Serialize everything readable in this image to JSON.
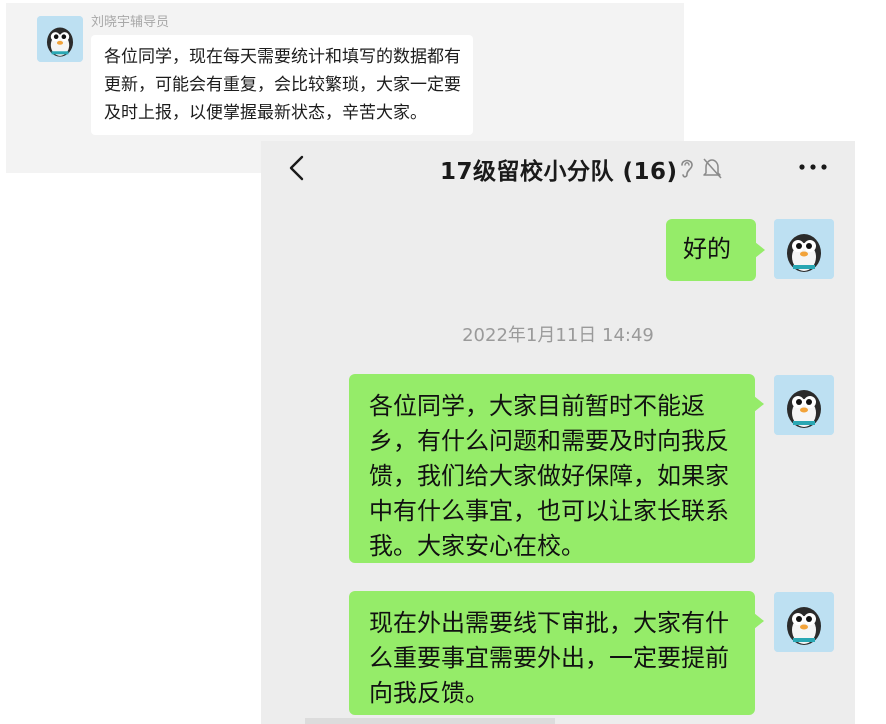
{
  "back_chat": {
    "sender": "刘晓宇辅导员",
    "message": "各位同学，现在每天需要统计和填写的数据都有更新，可能会有重复，会比较繁琐，大家一定要及时上报，以便掌握最新状态，辛苦大家。"
  },
  "front_chat": {
    "title": "17级留校小分队 (16)",
    "messages": [
      {
        "text": "好的"
      },
      {
        "text": "各位同学，大家目前暂时不能返乡，有什么问题和需要及时向我反馈，我们给大家做好保障，如果家中有什么事宜，也可以让家长联系我。大家安心在校。"
      },
      {
        "text": "现在外出需要线下审批，大家有什么重要事宜需要外出，一定要提前向我反馈。"
      }
    ],
    "timestamp": "2022年1月11日 14:49"
  },
  "colors": {
    "bubble_green": "#95ec69",
    "chat_background": "#ededed",
    "timestamp_gray": "#9a9a9a"
  },
  "icons": [
    "back-arrow-icon",
    "ear-icon",
    "mute-bell-icon",
    "more-icon",
    "penguin-avatar"
  ]
}
